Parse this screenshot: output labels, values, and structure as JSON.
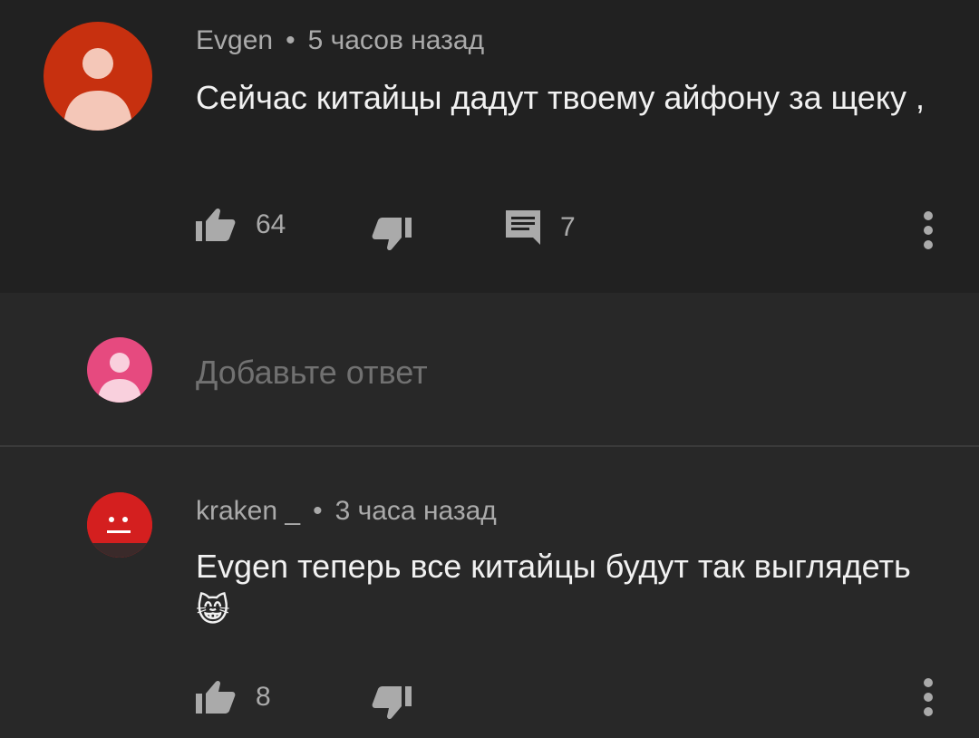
{
  "comment": {
    "author": "Evgen",
    "separator": "•",
    "time": "5 часов назад",
    "text": "Сейчас китайцы дадут твоему айфону  за щеку ,",
    "likes": "64",
    "replies": "7",
    "avatar_color": "#c7300f"
  },
  "reply_box": {
    "placeholder": "Добавьте ответ",
    "avatar_color": "#e64a7f"
  },
  "reply": {
    "author": "kraken _",
    "separator": "•",
    "time": "3 часа назад",
    "text": "Evgen теперь все китайцы будут так выглядеть",
    "emoji": "😸",
    "likes": "8",
    "avatar_color": "#d41f1f"
  },
  "icons": {
    "like": "thumbs-up-icon",
    "dislike": "thumbs-down-icon",
    "reply": "comment-icon",
    "more": "more-vert-icon"
  },
  "colors": {
    "background": "#212121",
    "secondary_background": "#282828",
    "primary_text": "#f1f1f1",
    "secondary_text": "#aaaaaa"
  }
}
